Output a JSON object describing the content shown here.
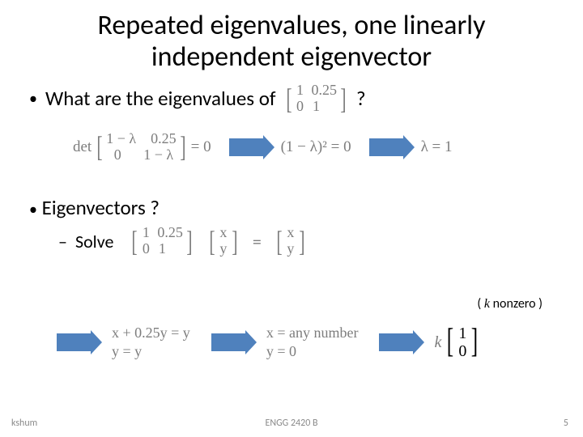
{
  "title": "Repeated eigenvalues, one linearly independent eigenvector",
  "bullet1_text": "What are the eigenvalues of",
  "qmark": "?",
  "matrixA": {
    "r1c1": "1",
    "r1c2": "0.25",
    "r2c1": "0",
    "r2c2": "1"
  },
  "det_prefix": "det",
  "det_matrix": {
    "r1c1": "1 − λ",
    "r1c2": "0.25",
    "r2c1": "0",
    "r2c2": "1 − λ"
  },
  "eq_zero": "= 0",
  "char_eq": "(1 − λ)² = 0",
  "lambda_result": "λ = 1",
  "bullet2_text": "Eigenvectors ?",
  "sub_bullet_text": "Solve",
  "solve_matrix": {
    "r1c1": "1",
    "r1c2": "0.25",
    "r2c1": "0",
    "r2c2": "1"
  },
  "vec_xy": {
    "r1": "x",
    "r2": "y"
  },
  "equals": "=",
  "note_open": "( ",
  "note_k": "k",
  "note_close": " nonzero )",
  "sys1": {
    "line1": "x + 0.25y = y",
    "line2": "y = y"
  },
  "sys2": {
    "line1": "x = any number",
    "line2": "y = 0"
  },
  "k_label": "k",
  "k_vec": {
    "r1": "1",
    "r2": "0"
  },
  "footer_left": "kshum",
  "footer_center": "ENGG 2420 B",
  "footer_right": "5"
}
